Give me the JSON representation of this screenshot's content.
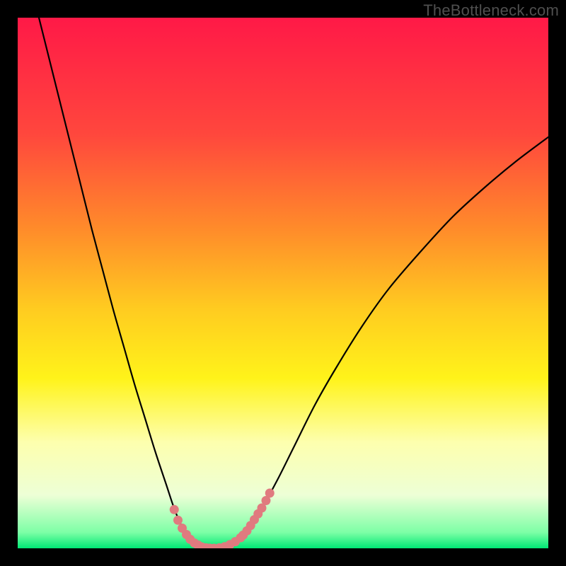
{
  "watermark": "TheBottleneck.com",
  "chart_data": {
    "type": "line",
    "title": "",
    "xlabel": "",
    "ylabel": "",
    "xlim": [
      0,
      100
    ],
    "ylim": [
      0,
      100
    ],
    "grid": false,
    "legend": false,
    "gradient_stops": [
      {
        "offset": 0,
        "color": "#ff1947"
      },
      {
        "offset": 22,
        "color": "#ff473d"
      },
      {
        "offset": 40,
        "color": "#ff8c2a"
      },
      {
        "offset": 55,
        "color": "#ffcc20"
      },
      {
        "offset": 68,
        "color": "#fff31a"
      },
      {
        "offset": 80,
        "color": "#fdffae"
      },
      {
        "offset": 90,
        "color": "#edffd6"
      },
      {
        "offset": 97,
        "color": "#7dffa6"
      },
      {
        "offset": 100,
        "color": "#00e874"
      }
    ],
    "series": [
      {
        "name": "left-arm",
        "type": "line",
        "x": [
          4,
          6,
          8,
          10,
          12,
          14,
          16,
          18,
          20,
          22,
          24,
          26,
          28,
          29.5,
          31,
          32.5,
          34,
          35.5,
          36.5
        ],
        "y": [
          100,
          92,
          84,
          76,
          68,
          60,
          52.5,
          45,
          38,
          31,
          24.5,
          18,
          12,
          7.5,
          4,
          1.8,
          0.6,
          0.1,
          0
        ]
      },
      {
        "name": "right-arm",
        "type": "line",
        "x": [
          36.5,
          38,
          40,
          42,
          44,
          46,
          49,
          52,
          56,
          60,
          65,
          70,
          76,
          82,
          88,
          94,
          100
        ],
        "y": [
          0,
          0.1,
          0.7,
          2,
          4.2,
          7.5,
          13,
          19,
          27,
          34,
          42,
          49,
          56,
          62.5,
          68,
          73,
          77.5
        ]
      },
      {
        "name": "highlight-left",
        "type": "scatter",
        "x": [
          29.5,
          30.2,
          31,
          31.8,
          32.5,
          33.3,
          34,
          34.7,
          35.5,
          36.2
        ],
        "y": [
          7.3,
          5.3,
          3.8,
          2.6,
          1.7,
          1.0,
          0.55,
          0.25,
          0.08,
          0.02
        ]
      },
      {
        "name": "highlight-floor",
        "type": "scatter",
        "x": [
          34,
          35,
          36,
          37,
          38,
          39,
          40,
          41,
          42
        ],
        "y": [
          0.6,
          0.1,
          0,
          0,
          0.08,
          0.3,
          0.7,
          1.25,
          2.0
        ]
      },
      {
        "name": "highlight-right",
        "type": "scatter",
        "x": [
          42.5,
          43.2,
          43.9,
          44.6,
          45.3,
          46,
          46.8,
          47.5
        ],
        "y": [
          2.5,
          3.3,
          4.3,
          5.4,
          6.5,
          7.6,
          9,
          10.4
        ]
      }
    ],
    "colors": {
      "curve": "#000000",
      "highlight": "#e07a7f"
    }
  }
}
